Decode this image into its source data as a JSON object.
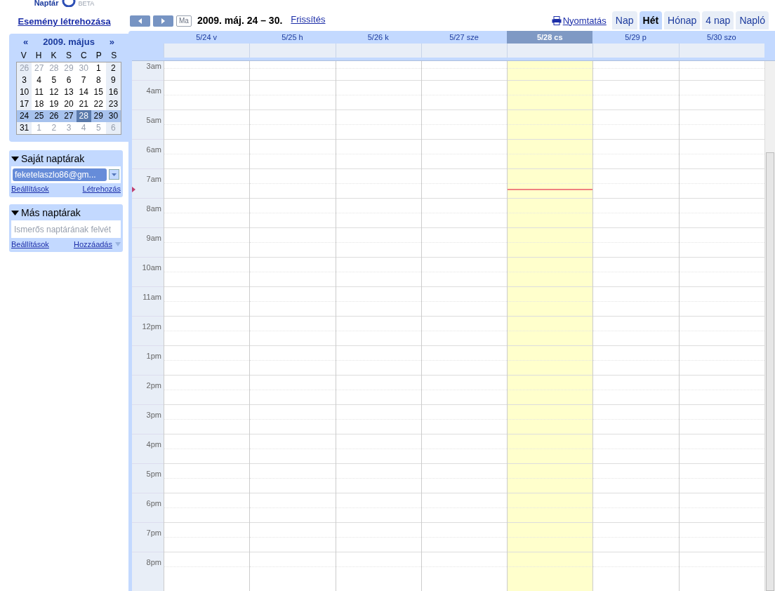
{
  "logo": {
    "name": "Naptár",
    "badge": "BETA"
  },
  "create_event": "Esemény létrehozása",
  "mini_calendar": {
    "prev": "«",
    "title": "2009. május",
    "next": "»",
    "weekdays": [
      "V",
      "H",
      "K",
      "S",
      "C",
      "P",
      "S"
    ],
    "weeks": [
      {
        "selected": false,
        "days": [
          {
            "label": "26",
            "other_month": true,
            "today": false
          },
          {
            "label": "27",
            "other_month": true,
            "today": false
          },
          {
            "label": "28",
            "other_month": true,
            "today": false
          },
          {
            "label": "29",
            "other_month": true,
            "today": false
          },
          {
            "label": "30",
            "other_month": true,
            "today": false
          },
          {
            "label": "1",
            "other_month": false,
            "today": false
          },
          {
            "label": "2",
            "other_month": false,
            "today": false
          }
        ]
      },
      {
        "selected": false,
        "days": [
          {
            "label": "3",
            "other_month": false,
            "today": false
          },
          {
            "label": "4",
            "other_month": false,
            "today": false
          },
          {
            "label": "5",
            "other_month": false,
            "today": false
          },
          {
            "label": "6",
            "other_month": false,
            "today": false
          },
          {
            "label": "7",
            "other_month": false,
            "today": false
          },
          {
            "label": "8",
            "other_month": false,
            "today": false
          },
          {
            "label": "9",
            "other_month": false,
            "today": false
          }
        ]
      },
      {
        "selected": false,
        "days": [
          {
            "label": "10",
            "other_month": false,
            "today": false
          },
          {
            "label": "11",
            "other_month": false,
            "today": false
          },
          {
            "label": "12",
            "other_month": false,
            "today": false
          },
          {
            "label": "13",
            "other_month": false,
            "today": false
          },
          {
            "label": "14",
            "other_month": false,
            "today": false
          },
          {
            "label": "15",
            "other_month": false,
            "today": false
          },
          {
            "label": "16",
            "other_month": false,
            "today": false
          }
        ]
      },
      {
        "selected": false,
        "days": [
          {
            "label": "17",
            "other_month": false,
            "today": false
          },
          {
            "label": "18",
            "other_month": false,
            "today": false
          },
          {
            "label": "19",
            "other_month": false,
            "today": false
          },
          {
            "label": "20",
            "other_month": false,
            "today": false
          },
          {
            "label": "21",
            "other_month": false,
            "today": false
          },
          {
            "label": "22",
            "other_month": false,
            "today": false
          },
          {
            "label": "23",
            "other_month": false,
            "today": false
          }
        ]
      },
      {
        "selected": true,
        "days": [
          {
            "label": "24",
            "other_month": false,
            "today": false
          },
          {
            "label": "25",
            "other_month": false,
            "today": false
          },
          {
            "label": "26",
            "other_month": false,
            "today": false
          },
          {
            "label": "27",
            "other_month": false,
            "today": false
          },
          {
            "label": "28",
            "other_month": false,
            "today": true
          },
          {
            "label": "29",
            "other_month": false,
            "today": false
          },
          {
            "label": "30",
            "other_month": false,
            "today": false
          }
        ]
      },
      {
        "selected": false,
        "days": [
          {
            "label": "31",
            "other_month": false,
            "today": false
          },
          {
            "label": "1",
            "other_month": true,
            "today": false
          },
          {
            "label": "2",
            "other_month": true,
            "today": false
          },
          {
            "label": "3",
            "other_month": true,
            "today": false
          },
          {
            "label": "4",
            "other_month": true,
            "today": false
          },
          {
            "label": "5",
            "other_month": true,
            "today": false
          },
          {
            "label": "6",
            "other_month": true,
            "today": false
          }
        ]
      }
    ]
  },
  "my_calendars": {
    "title": "Saját naptárak",
    "expanded": true,
    "calendar": "feketelaszlo86@gm...",
    "links": [
      "Beállítások",
      "Létrehozás"
    ]
  },
  "other_calendars": {
    "title": "Más naptárak",
    "expanded": true,
    "placeholder": "Ismerős naptárának felvét",
    "links": [
      "Beállítások",
      "Hozzáadás"
    ]
  },
  "toolbar": {
    "today": "Ma",
    "range": "2009. máj. 24 – 30.",
    "refresh": "Frissítés",
    "print": "Nyomtatás"
  },
  "view_tabs": [
    {
      "label": "Nap",
      "selected": false
    },
    {
      "label": "Hét",
      "selected": true
    },
    {
      "label": "Hónap",
      "selected": false
    },
    {
      "label": "4 nap",
      "selected": false
    },
    {
      "label": "Napló",
      "selected": false
    }
  ],
  "days": [
    {
      "label": "5/24 v",
      "today": false
    },
    {
      "label": "5/25 h",
      "today": false
    },
    {
      "label": "5/26 k",
      "today": false
    },
    {
      "label": "5/27 sze",
      "today": false
    },
    {
      "label": "5/28 cs",
      "today": true
    },
    {
      "label": "5/29 p",
      "today": false
    },
    {
      "label": "5/30 szo",
      "today": false
    }
  ],
  "hours": [
    "3am",
    "4am",
    "5am",
    "6am",
    "7am",
    "8am",
    "9am",
    "10am",
    "11am",
    "12pm",
    "1pm",
    "2pm",
    "3pm",
    "4pm",
    "5pm",
    "6pm",
    "7pm",
    "8pm"
  ]
}
